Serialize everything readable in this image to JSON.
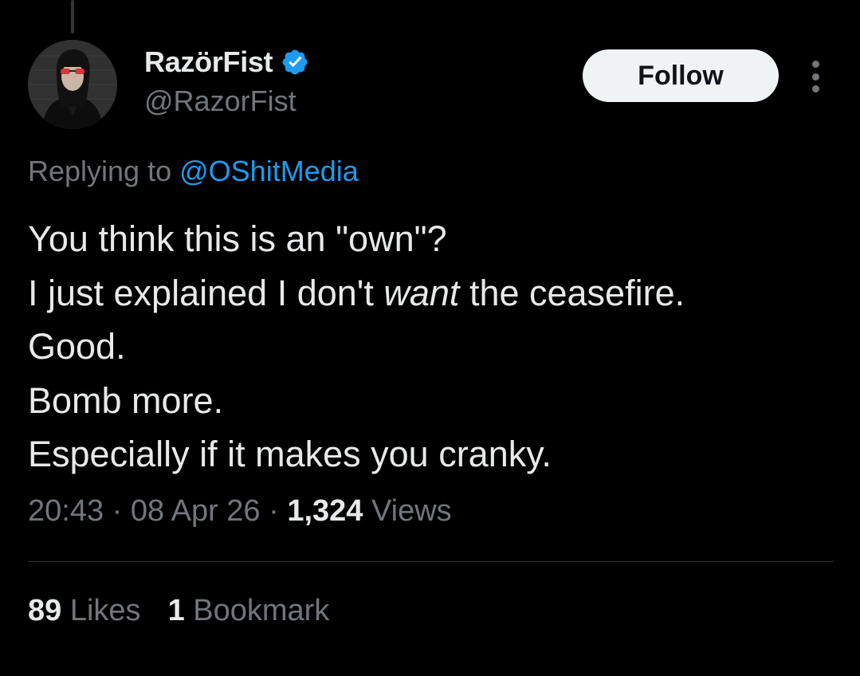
{
  "colors": {
    "background": "#000000",
    "text_primary": "#e7e9ea",
    "text_secondary": "#71767b",
    "accent": "#1d9bf0",
    "verified_badge": "#1d9bf0",
    "follow_button_bg": "#eff3f4",
    "divider": "#2f3336"
  },
  "author": {
    "display_name": "RazörFist",
    "handle": "@RazorFist",
    "verified": true,
    "verified_icon": "verified-badge-icon",
    "avatar_icon": "profile-photo-avatar"
  },
  "actions": {
    "follow_label": "Follow",
    "more_icon": "more-vertical-icon"
  },
  "reply": {
    "prefix": "Replying to ",
    "mention": "@OShitMedia"
  },
  "tweet": {
    "line1": "You think this is an \"own\"?",
    "line2_before": "I just explained I don't ",
    "line2_emphasis": "want",
    "line2_after": " the ceasefire.",
    "line3": "Good.",
    "line4": "Bomb more.",
    "line5": "Especially if it makes you cranky."
  },
  "meta": {
    "time": "20:43",
    "separator": " · ",
    "date": "08 Apr 26",
    "views_count": "1,324",
    "views_label": " Views"
  },
  "stats": {
    "likes_count": "89",
    "likes_label": " Likes",
    "bookmarks_count": "1",
    "bookmarks_label": " Bookmark"
  }
}
